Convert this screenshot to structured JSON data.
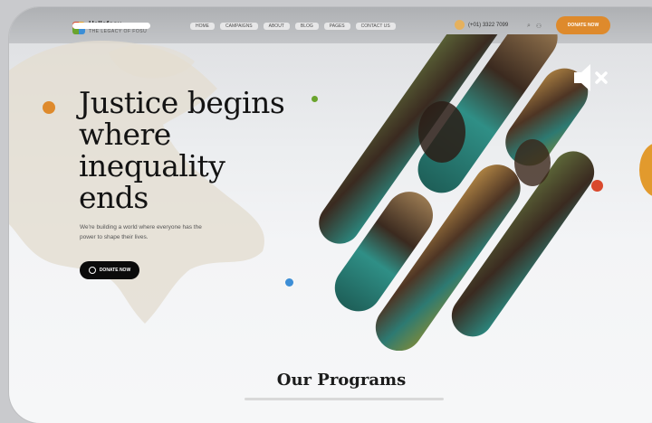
{
  "header": {
    "logo_name": "Hellofosu",
    "logo_tagline": "THE LEGACY OF FOSU",
    "nav": [
      "HOME",
      "CAMPAIGNS",
      "ABOUT",
      "BLOG",
      "PAGES",
      "CONTACT US"
    ],
    "phone": "(+01) 3322 7099",
    "donate_label": "DONATE NOW"
  },
  "hero": {
    "title": "Justice begins where inequality ends",
    "subtitle": "We're building a world where everyone has the power to shape their lives.",
    "button_label": "DONATE NOW"
  },
  "colors": {
    "accent_orange": "#de8a2c",
    "accent_red": "#d9492d",
    "accent_green": "#6aa42d",
    "accent_blue": "#3c8ed6"
  },
  "video": {
    "muted": true
  },
  "programs": {
    "title": "Our Programs"
  }
}
